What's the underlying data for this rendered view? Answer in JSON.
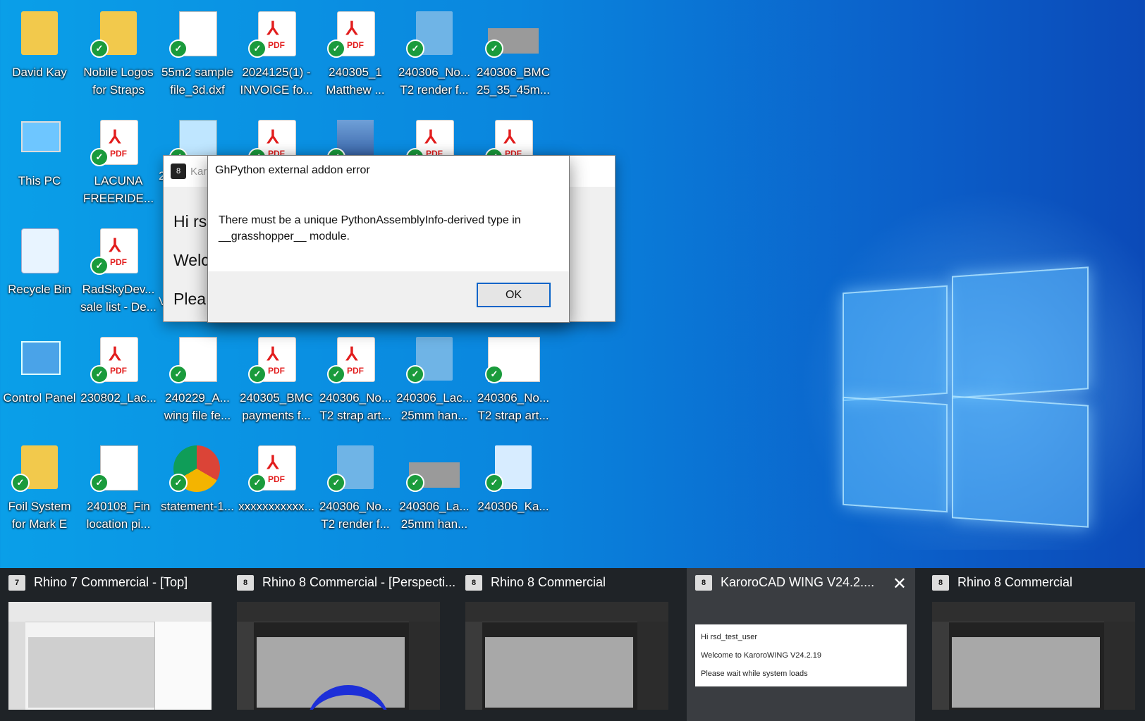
{
  "desktop": {
    "icons": [
      {
        "label": "David Kay",
        "type": "folder",
        "check": false
      },
      {
        "label": "Nobile Logos for Straps",
        "type": "folder",
        "check": true
      },
      {
        "label": "55m2 sample file_3d.dxf",
        "type": "file",
        "check": true
      },
      {
        "label": "2024125(1) - INVOICE fo...",
        "type": "pdf",
        "check": true
      },
      {
        "label": "240305_1 Matthew ...",
        "type": "pdf",
        "check": true
      },
      {
        "label": "240306_No... T2 render f...",
        "type": "rhino",
        "check": true
      },
      {
        "label": "240306_BMC 25_35_45m...",
        "type": "image",
        "check": true
      },
      {
        "label": "This PC",
        "type": "pc",
        "check": false
      },
      {
        "label": "LACUNA FREERIDE...",
        "type": "pdf",
        "check": true
      },
      {
        "label": "Recycle Bin",
        "type": "bin",
        "check": false
      },
      {
        "label": "RadSkyDev... sale list - De...",
        "type": "pdf",
        "check": true
      },
      {
        "label": "Control Panel",
        "type": "cp",
        "check": false
      },
      {
        "label": "230802_Lac...",
        "type": "pdf",
        "check": true
      },
      {
        "label": "240229_A... wing file fe...",
        "type": "text",
        "check": true
      },
      {
        "label": "240305_BMC payments f...",
        "type": "pdf",
        "check": true
      },
      {
        "label": "240306_No... T2 strap art...",
        "type": "pdf",
        "check": true
      },
      {
        "label": "240306_Lac... 25mm han...",
        "type": "rhino",
        "check": true
      },
      {
        "label": "240306_No... T2 strap art...",
        "type": "image",
        "check": true
      },
      {
        "label": "Foil System for Mark E",
        "type": "folder",
        "check": true
      },
      {
        "label": "240108_Fin location pi...",
        "type": "text",
        "check": true
      },
      {
        "label": "statement-1...",
        "type": "chrome",
        "check": true
      },
      {
        "label": "xxxxxxxxxxx...",
        "type": "pdf",
        "check": true
      },
      {
        "label": "240306_No... T2 render f...",
        "type": "rhino",
        "check": true
      },
      {
        "label": "240306_La... 25mm han...",
        "type": "image",
        "check": true
      },
      {
        "label": "240306_Ka...",
        "type": "rhino",
        "check": true
      }
    ],
    "pdf_tag": "PDF",
    "partial_labels": {
      "row2col3": "2",
      "row3col3": "V"
    }
  },
  "background_dialog": {
    "title": "Kar",
    "lines": [
      "Hi rs",
      "Welc",
      "Plea"
    ]
  },
  "error_dialog": {
    "title": "GhPython external addon error",
    "message": "There must be a unique PythonAssemblyInfo-derived type in __grasshopper__ module.",
    "ok_label": "OK"
  },
  "taskbar": {
    "items": [
      {
        "title": "Rhino 7 Commercial - [Top]",
        "icon_text": "7"
      },
      {
        "title": "Rhino 8 Commercial - [Perspecti...",
        "icon_text": "8"
      },
      {
        "title": "Rhino 8 Commercial",
        "icon_text": "8"
      },
      {
        "title": "KaroroCAD WING V24.2....",
        "icon_text": "8",
        "close": "✕"
      },
      {
        "title": "Rhino 8 Commercial",
        "icon_text": "8"
      }
    ],
    "splash": {
      "line1": "Hi rsd_test_user",
      "line2": "Welcome to KaroroWING V24.2.19",
      "line3": "Please wait while system loads"
    }
  },
  "colors": {
    "accent": "#0a64c8",
    "check": "#1a9b3c",
    "pdf_red": "#e21d1d",
    "taskbar": "#1f2327"
  }
}
